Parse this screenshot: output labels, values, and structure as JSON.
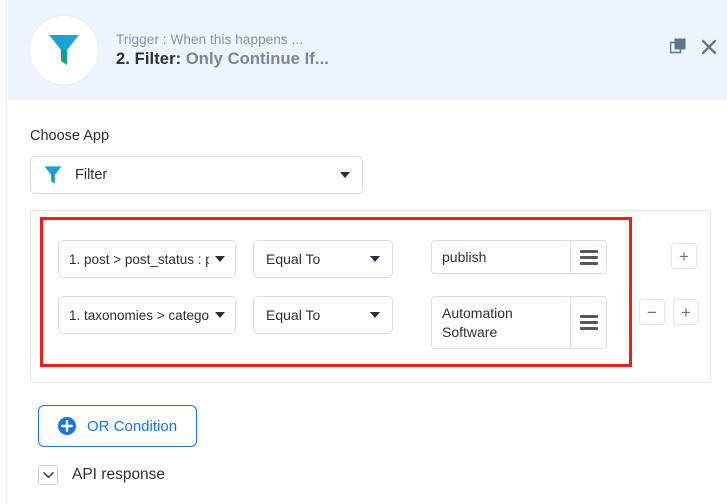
{
  "header": {
    "app_icon": "filter-funnel-icon",
    "subtitle": "Trigger : When this happens ...",
    "step_prefix": "2. Filter:",
    "step_name": " Only Continue If...",
    "duplicate_icon": "duplicate-icon",
    "close_icon": "close-icon"
  },
  "main": {
    "choose_app_label": "Choose App",
    "app_select": {
      "icon": "filter-funnel-icon",
      "value": "Filter",
      "caret_icon": "chevron-down-icon"
    },
    "conditions": [
      {
        "field": "1. post > post_status : p",
        "operator": "Equal To",
        "value": "publish",
        "menu_icon": "hamburger-icon",
        "add_label": "+",
        "remove_label": "−",
        "has_remove": false
      },
      {
        "field": "1. taxonomies > catego",
        "operator": "Equal To",
        "value": "Automation Software",
        "menu_icon": "hamburger-icon",
        "add_label": "+",
        "remove_label": "−",
        "has_remove": true
      }
    ],
    "or_condition": {
      "icon": "plus-circle-icon",
      "label": "OR Condition"
    },
    "api_response": {
      "icon": "chevron-down-icon",
      "label": "API response"
    }
  },
  "colors": {
    "header_bg": "#eef4fc",
    "accent_blue": "#1a73e8",
    "highlight_red": "#f01d1d",
    "funnel_top": "#1aa3e0",
    "funnel_bottom": "#17a589",
    "muted_text": "#8a93a0"
  }
}
